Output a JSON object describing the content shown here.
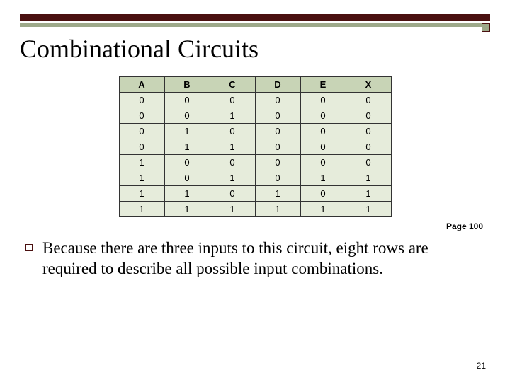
{
  "title": "Combinational Circuits",
  "page_ref": "Page 100",
  "slide_number": "21",
  "body": "Because there are three inputs to this circuit, eight rows are required to describe all possible input combinations.",
  "chart_data": {
    "type": "table",
    "columns": [
      "A",
      "B",
      "C",
      "D",
      "E",
      "X"
    ],
    "rows": [
      [
        "0",
        "0",
        "0",
        "0",
        "0",
        "0"
      ],
      [
        "0",
        "0",
        "1",
        "0",
        "0",
        "0"
      ],
      [
        "0",
        "1",
        "0",
        "0",
        "0",
        "0"
      ],
      [
        "0",
        "1",
        "1",
        "0",
        "0",
        "0"
      ],
      [
        "1",
        "0",
        "0",
        "0",
        "0",
        "0"
      ],
      [
        "1",
        "0",
        "1",
        "0",
        "1",
        "1"
      ],
      [
        "1",
        "1",
        "0",
        "1",
        "0",
        "1"
      ],
      [
        "1",
        "1",
        "1",
        "1",
        "1",
        "1"
      ]
    ]
  }
}
